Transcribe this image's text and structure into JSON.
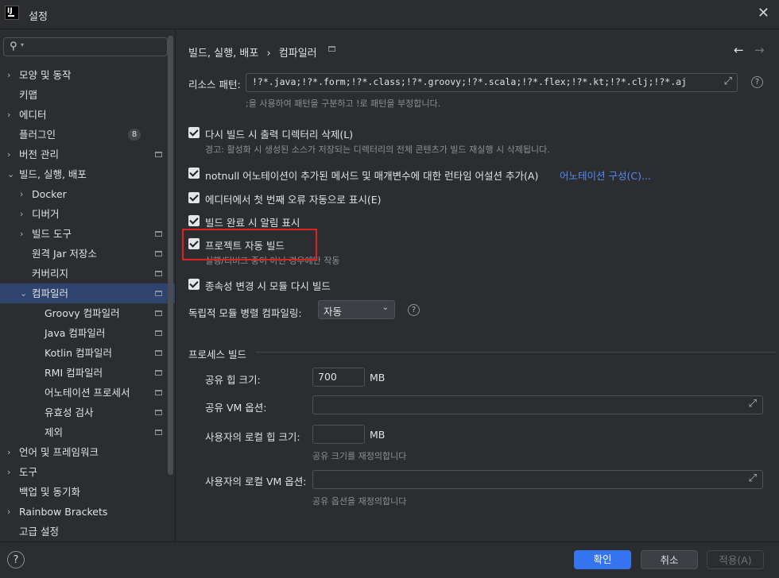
{
  "window": {
    "title": "설정"
  },
  "sidebar": {
    "search": {
      "value": "",
      "placeholder": ""
    },
    "items": [
      {
        "label": "모양 및 동작"
      },
      {
        "label": "키맵"
      },
      {
        "label": "에디터"
      },
      {
        "label": "플러그인",
        "badge": "8"
      },
      {
        "label": "버전 관리"
      },
      {
        "label": "빌드, 실행, 배포"
      },
      {
        "label": "Docker"
      },
      {
        "label": "디버거"
      },
      {
        "label": "빌드 도구"
      },
      {
        "label": "원격 Jar 저장소"
      },
      {
        "label": "커버리지"
      },
      {
        "label": "컴파일러"
      },
      {
        "label": "Groovy 컴파일러"
      },
      {
        "label": "Java 컴파일러"
      },
      {
        "label": "Kotlin 컴파일러"
      },
      {
        "label": "RMI 컴파일러"
      },
      {
        "label": "어노테이션 프로세서"
      },
      {
        "label": "유효성 검사"
      },
      {
        "label": "제외"
      },
      {
        "label": "언어 및 프레임워크"
      },
      {
        "label": "도구"
      },
      {
        "label": "백업 및 동기화"
      },
      {
        "label": "Rainbow Brackets"
      },
      {
        "label": "고급 설정"
      }
    ]
  },
  "breadcrumb": {
    "parent": "빌드, 실행, 배포",
    "sep": "›",
    "current": "컴파일러"
  },
  "resource": {
    "label": "리소스 패턴:",
    "value": "!?*.java;!?*.form;!?*.class;!?*.groovy;!?*.scala;!?*.flex;!?*.kt;!?*.clj;!?*.aj",
    "hint": ";을 사용하여 패턴을 구분하고 !로 패턴을 부정합니다."
  },
  "options": [
    {
      "label": "다시 빌드 시 출력 디렉터리 삭제(L)",
      "checked": true,
      "hint": "경고: 활성화 시 생성된 소스가 저장되는 디렉터리의 전체 콘텐츠가 빌드 재실행 시 삭제됩니다."
    },
    {
      "label": "notnull 어노테이션이 추가된 메서드 및 매개변수에 대한 런타임 어설션 추가(A)",
      "checked": true,
      "link": "어노테이션 구성(C)..."
    },
    {
      "label": "에디터에서 첫 번째 오류 자동으로 표시(E)",
      "checked": true
    },
    {
      "label": "빌드 완료 시 알림 표시",
      "checked": true
    },
    {
      "label": "프로젝트 자동 빌드",
      "checked": true,
      "hint": "실행/디버그 중이 아닌 경우에만 작동"
    },
    {
      "label": "종속성 변경 시 모듈 다시 빌드",
      "checked": true
    }
  ],
  "parallel": {
    "label": "독립적 모듈 병렬 컴파일링:",
    "value": "자동"
  },
  "process": {
    "title": "프로세스 빌드",
    "shared_heap": {
      "label": "공유 힙 크기:",
      "value": "700",
      "unit": "MB"
    },
    "shared_vm": {
      "label": "공유 VM 옵션:",
      "value": ""
    },
    "user_heap": {
      "label": "사용자의 로컬 힙 크기:",
      "value": "",
      "unit": "MB",
      "hint": "공유 크기를 재정의합니다"
    },
    "user_vm": {
      "label": "사용자의 로컬 VM 옵션:",
      "value": "",
      "hint": "공유 옵션을 재정의합니다"
    }
  },
  "footer": {
    "ok": "확인",
    "cancel": "취소",
    "apply": "적용(A)"
  },
  "colors": {
    "accent": "#3574f0",
    "selection": "#2e436e",
    "highlight_box": "#e0221f",
    "link": "#548af7"
  }
}
